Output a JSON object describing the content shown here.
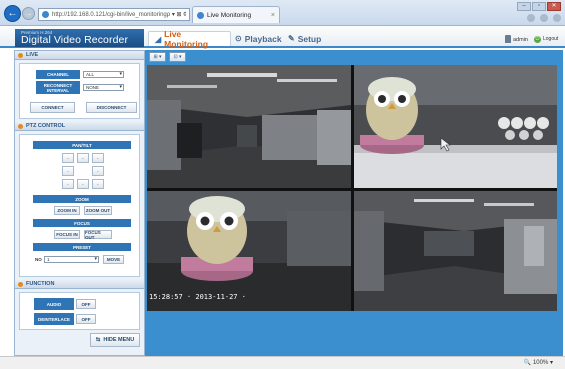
{
  "browser": {
    "url": "http://192.168.0.121/cgi-bin/live_monitoring",
    "url_tools": "ρ ▾ ⊠ ¢",
    "tab_title": "Live Monitoring",
    "tab_close": "×"
  },
  "app": {
    "logo_small": "Premium H.264",
    "logo_title": "Digital Video Recorder",
    "tabs": [
      {
        "label": "Live Monitoring",
        "icon": "camera-icon"
      },
      {
        "label": "Playback",
        "icon": "play-icon"
      },
      {
        "label": "Setup",
        "icon": "wrench-icon"
      }
    ],
    "user": "admin",
    "logout": "Logout"
  },
  "live": {
    "title": "LIVE",
    "channel_label": "CHANNEL",
    "channel_value": "ALL",
    "reconnect_label": "RECONNECT INTERVAL",
    "reconnect_value": "NONE",
    "connect": "CONNECT",
    "disconnect": "DISCONNECT"
  },
  "ptz": {
    "title": "PTZ CONTROL",
    "pan_tilt": "PAN/TILT",
    "zoom": "ZOOM",
    "zoom_in": "ZOOM IN",
    "zoom_out": "ZOOM OUT",
    "focus": "FOCUS",
    "focus_in": "FOCUS IN",
    "focus_out": "FOCUS OUT",
    "preset": "PRESET",
    "preset_no": "NO",
    "preset_value": "1",
    "move": "MOVE"
  },
  "function": {
    "title": "FUNCTION",
    "audio_label": "AUDIO",
    "audio_value": "OFF",
    "deinterlace_label": "DEINTERLACE",
    "deinterlace_value": "OFF"
  },
  "hide_menu": "HIDE MENU",
  "split_buttons": [
    "⊞ ▾",
    "⊡ ▾"
  ],
  "osd": {
    "timestamp": "15:28:57 · 2013-11-27 ·"
  },
  "status": {
    "zoom": "100%"
  }
}
